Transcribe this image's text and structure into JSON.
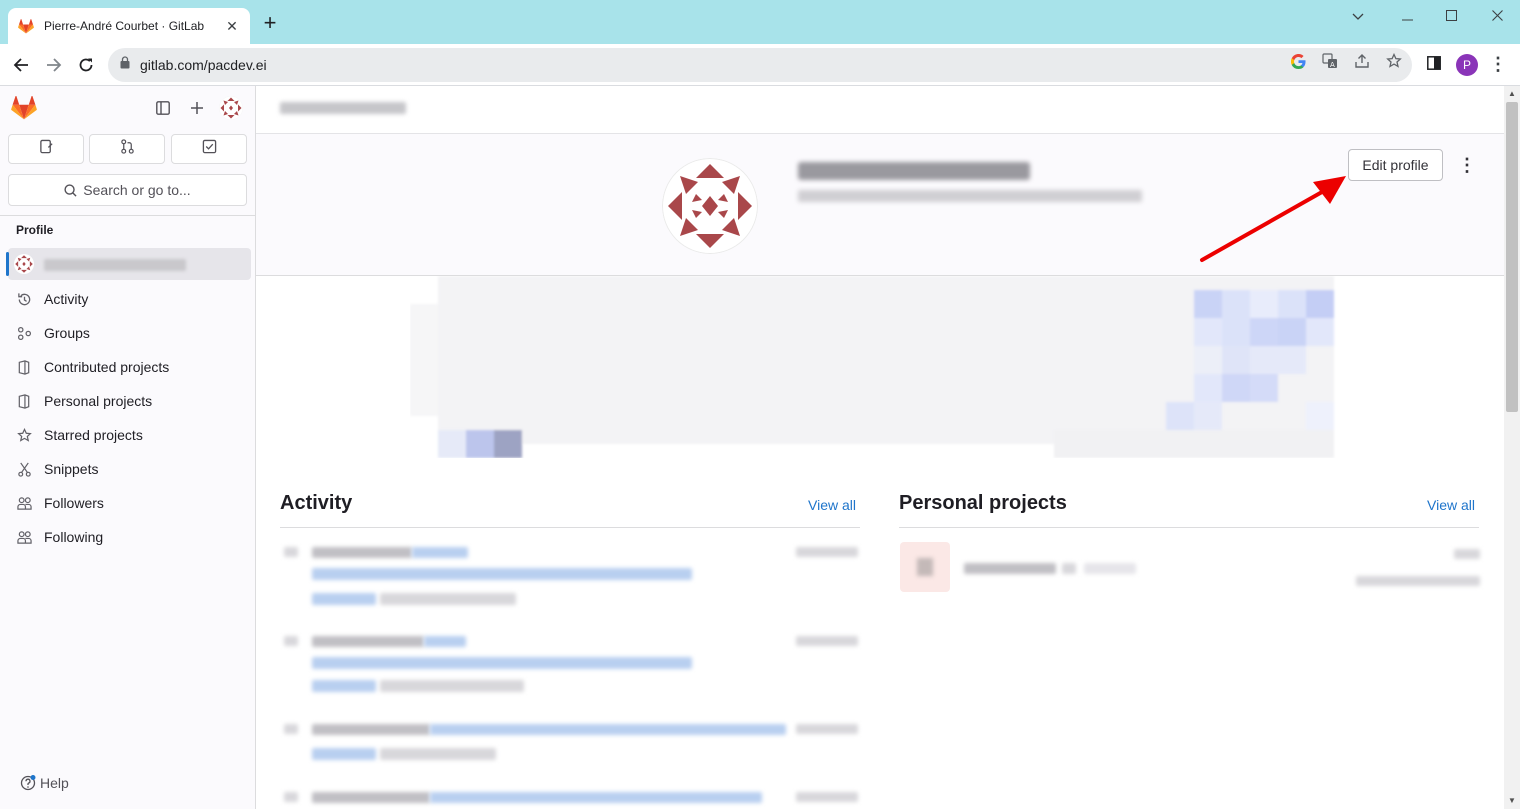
{
  "browser": {
    "tab_title": "Pierre-André Courbet · GitLab",
    "tab_close": "✕",
    "new_tab": "+",
    "url": "gitlab.com/pacdev.ei",
    "profile_initial": "P",
    "window_controls": [
      "chevron-down",
      "minimize",
      "maximize",
      "close"
    ]
  },
  "sidebar": {
    "search_placeholder": "Search or go to...",
    "section_label": "Profile",
    "items": [
      {
        "label": "Activity",
        "icon": "history-icon"
      },
      {
        "label": "Groups",
        "icon": "group-icon"
      },
      {
        "label": "Contributed projects",
        "icon": "project-icon"
      },
      {
        "label": "Personal projects",
        "icon": "project-icon"
      },
      {
        "label": "Starred projects",
        "icon": "star-icon"
      },
      {
        "label": "Snippets",
        "icon": "snippet-icon"
      },
      {
        "label": "Followers",
        "icon": "users-icon"
      },
      {
        "label": "Following",
        "icon": "users-icon"
      }
    ],
    "help_label": "Help"
  },
  "profile": {
    "edit_button": "Edit profile",
    "more_actions": "⋮"
  },
  "sections": {
    "activity_title": "Activity",
    "activity_view_all": "View all",
    "projects_title": "Personal projects",
    "projects_view_all": "View all"
  },
  "colors": {
    "gitlab_orange": "#e24329",
    "link_blue": "#1f75cb",
    "annotation_red": "#ec0000",
    "avatar_red": "#a9474a"
  }
}
